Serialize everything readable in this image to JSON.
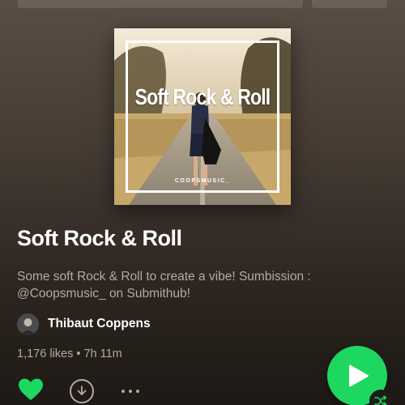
{
  "playlist": {
    "cover": {
      "title": "Soft Rock & Roll",
      "brand": "COOPSMUSIC_"
    },
    "title": "Soft Rock & Roll",
    "description": "Some soft Rock & Roll to create a vibe! Sumbission : @Coopsmusic_ on Submithub!",
    "owner": "Thibaut Coppens",
    "meta": "1,176 likes • 7h 11m"
  },
  "colors": {
    "accent": "#1ed760",
    "text_secondary": "#b3aaa2"
  },
  "icons": {
    "like": "heart-icon",
    "download": "download-icon",
    "more": "more-icon",
    "play": "play-icon",
    "shuffle": "shuffle-icon"
  }
}
